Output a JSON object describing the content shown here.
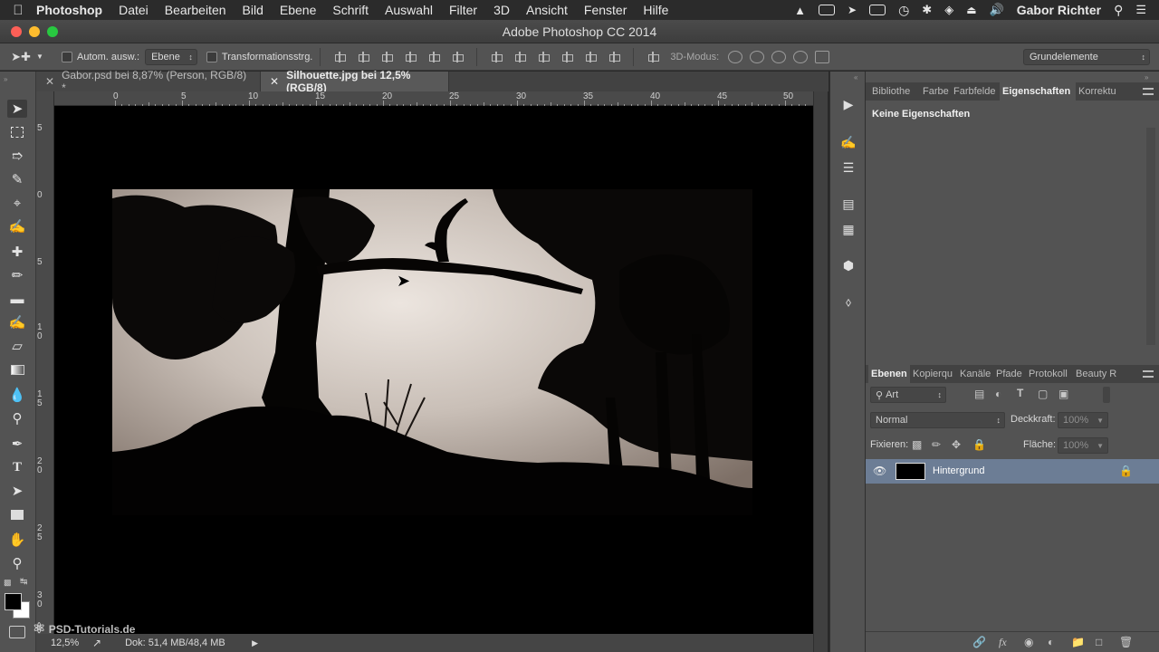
{
  "menubar": {
    "app": "Photoshop",
    "items": [
      "Datei",
      "Bearbeiten",
      "Bild",
      "Ebene",
      "Schrift",
      "Auswahl",
      "Filter",
      "3D",
      "Ansicht",
      "Fenster",
      "Hilfe"
    ],
    "user": "Gabor Richter"
  },
  "window": {
    "title": "Adobe Photoshop CC 2014"
  },
  "options": {
    "auto_select_label": "Autom. ausw.:",
    "auto_select_value": "Ebene",
    "transform_label": "Transformationsstrg.",
    "mode3d_label": "3D-Modus:",
    "workspace": "Grundelemente"
  },
  "tabs": [
    {
      "label": "Gabor.psd bei 8,87% (Person, RGB/8) *",
      "active": false
    },
    {
      "label": "Silhouette.jpg bei 12,5% (RGB/8)",
      "active": true
    }
  ],
  "ruler": {
    "h_ticks": [
      "0",
      "5",
      "10",
      "15",
      "20",
      "25",
      "30",
      "35",
      "40",
      "45",
      "50"
    ],
    "v_ticks": [
      [
        "5"
      ],
      [
        "0"
      ],
      [
        "5"
      ],
      [
        "1",
        "0"
      ],
      [
        "1",
        "5"
      ],
      [
        "2",
        "0"
      ],
      [
        "2",
        "5"
      ],
      [
        "3",
        "0"
      ]
    ]
  },
  "status": {
    "zoom": "12,5%",
    "doc": "Dok: 51,4 MB/48,4 MB"
  },
  "watermark": "PSD-Tutorials.de",
  "properties_panel": {
    "tabs": [
      "Bibliothe",
      "Farbe",
      "Farbfelde",
      "Eigenschaften",
      "Korrektu"
    ],
    "active_tab": "Eigenschaften",
    "empty_text": "Keine Eigenschaften"
  },
  "layers_panel": {
    "tabs": [
      "Ebenen",
      "Kopierqu",
      "Kanäle",
      "Pfade",
      "Protokoll",
      "Beauty R"
    ],
    "active_tab": "Ebenen",
    "filter_value": "Art",
    "blend_mode": "Normal",
    "opacity_label": "Deckkraft:",
    "opacity_value": "100%",
    "lock_label": "Fixieren:",
    "fill_label": "Fläche:",
    "fill_value": "100%",
    "layers": [
      {
        "name": "Hintergrund",
        "visible": true,
        "locked": true
      }
    ]
  },
  "colors": {
    "ui_bg": "#535353",
    "selected_layer": "#6c7d95",
    "canvas": "#000000"
  }
}
